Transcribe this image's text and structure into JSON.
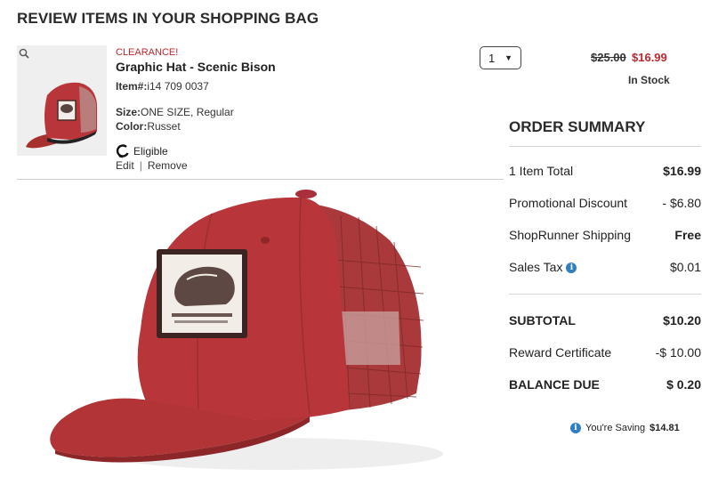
{
  "page": {
    "title": "REVIEW ITEMS IN YOUR SHOPPING BAG"
  },
  "item": {
    "badge": "CLEARANCE!",
    "name": "Graphic Hat - Scenic Bison",
    "item_label": "Item#:",
    "item_number": "i14 709 0037",
    "size_label": "Size:",
    "size_value": "ONE SIZE, Regular",
    "color_label": "Color:",
    "color_value": "Russet",
    "eligible_text": "Eligible",
    "edit_label": "Edit",
    "separator": "|",
    "remove_label": "Remove",
    "quantity": "1",
    "price_original": "$25.00",
    "price_sale": "$16.99",
    "stock_status": "In Stock",
    "icons": [
      "magnifier-icon",
      "shoprunner-icon",
      "chevron-down-icon"
    ]
  },
  "summary": {
    "title": "ORDER SUMMARY",
    "rows": [
      {
        "label": "1 Item Total",
        "value": "$16.99"
      },
      {
        "label": "Promotional Discount",
        "value": "- $6.80"
      },
      {
        "label": "ShopRunner Shipping",
        "value": "Free"
      },
      {
        "label": "Sales Tax",
        "value": "$0.01"
      },
      {
        "label": "SUBTOTAL",
        "value": "$10.20"
      },
      {
        "label": "Reward Certificate",
        "value": "-$ 10.00"
      },
      {
        "label": "BALANCE DUE",
        "value": "$ 0.20"
      }
    ],
    "saving_prefix": "You're Saving",
    "saving_amount": "$14.81",
    "info_glyph": "i"
  },
  "colors": {
    "accent_red": "#c0272d",
    "info_blue": "#2f7fc1",
    "hat_red": "#b8363a"
  }
}
